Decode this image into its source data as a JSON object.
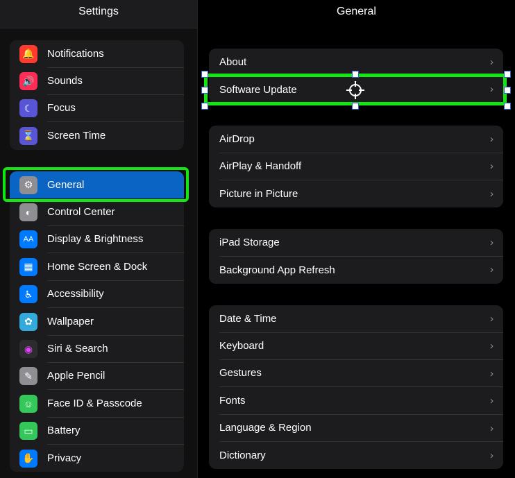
{
  "sidebar": {
    "title": "Settings",
    "groups": [
      {
        "items": [
          {
            "label": "Notifications",
            "icon": "bell-icon",
            "color": "#ff3b30",
            "glyph": "🔔"
          },
          {
            "label": "Sounds",
            "icon": "speaker-icon",
            "color": "#ff2d55",
            "glyph": "🔊"
          },
          {
            "label": "Focus",
            "icon": "moon-icon",
            "color": "#5856d6",
            "glyph": "☾"
          },
          {
            "label": "Screen Time",
            "icon": "hourglass-icon",
            "color": "#5856d6",
            "glyph": "⌛"
          }
        ]
      },
      {
        "items": [
          {
            "label": "General",
            "icon": "gear-icon",
            "color": "#8e8e93",
            "glyph": "⚙",
            "selected": true
          },
          {
            "label": "Control Center",
            "icon": "toggles-icon",
            "color": "#8e8e93",
            "glyph": "◐"
          },
          {
            "label": "Display & Brightness",
            "icon": "text-size-icon",
            "color": "#007aff",
            "glyph": "AA"
          },
          {
            "label": "Home Screen & Dock",
            "icon": "grid-icon",
            "color": "#007aff",
            "glyph": "▦"
          },
          {
            "label": "Accessibility",
            "icon": "accessibility-icon",
            "color": "#007aff",
            "glyph": "♿"
          },
          {
            "label": "Wallpaper",
            "icon": "flower-icon",
            "color": "#34aadc",
            "glyph": "✿"
          },
          {
            "label": "Siri & Search",
            "icon": "siri-icon",
            "color": "#2c2c2e",
            "glyph": "◉"
          },
          {
            "label": "Apple Pencil",
            "icon": "pencil-icon",
            "color": "#8e8e93",
            "glyph": "✎"
          },
          {
            "label": "Face ID & Passcode",
            "icon": "faceid-icon",
            "color": "#34c759",
            "glyph": "☺"
          },
          {
            "label": "Battery",
            "icon": "battery-icon",
            "color": "#34c759",
            "glyph": "▭"
          },
          {
            "label": "Privacy",
            "icon": "hand-icon",
            "color": "#007aff",
            "glyph": "✋"
          }
        ]
      }
    ]
  },
  "main": {
    "title": "General",
    "groups": [
      {
        "items": [
          "About",
          "Software Update"
        ]
      },
      {
        "items": [
          "AirDrop",
          "AirPlay & Handoff",
          "Picture in Picture"
        ]
      },
      {
        "items": [
          "iPad Storage",
          "Background App Refresh"
        ]
      },
      {
        "items": [
          "Date & Time",
          "Keyboard",
          "Gestures",
          "Fonts",
          "Language & Region",
          "Dictionary"
        ]
      }
    ]
  },
  "colors": {
    "accent": "#0a64c3",
    "highlight": "#14e614"
  }
}
